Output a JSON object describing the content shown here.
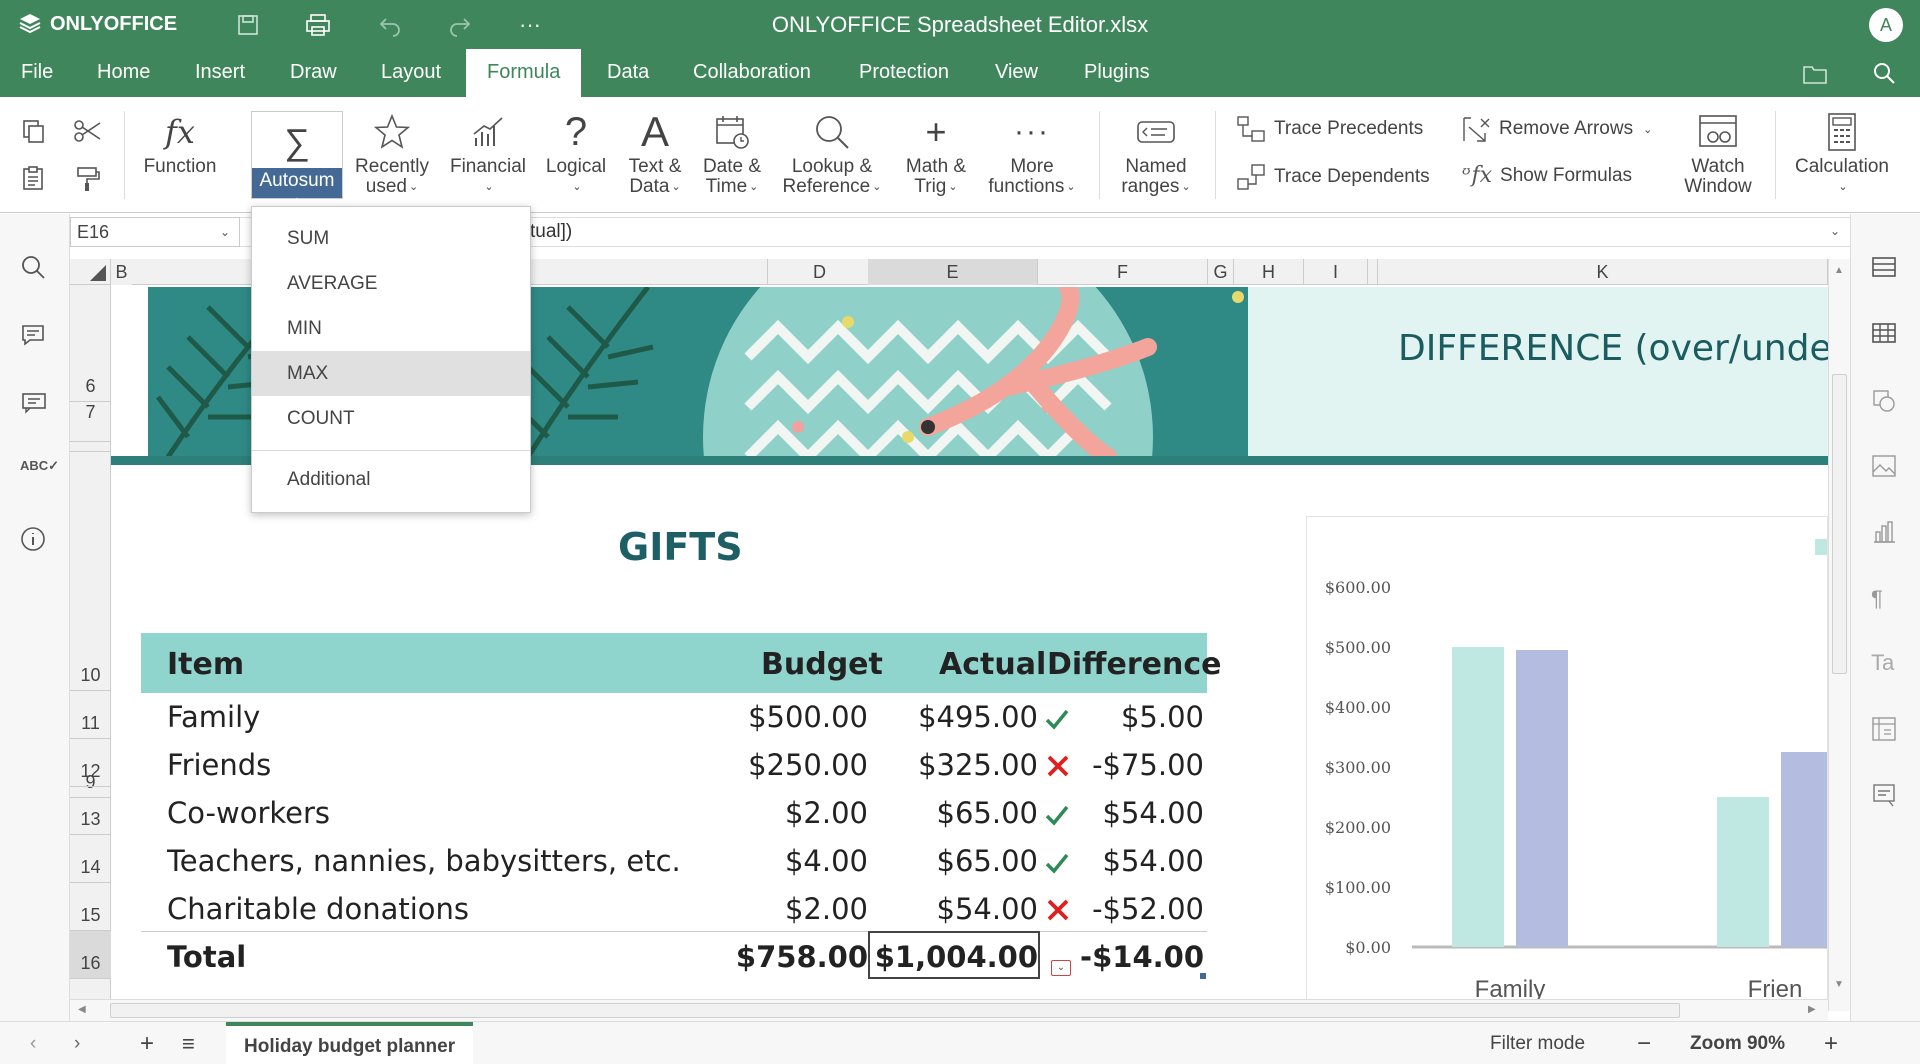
{
  "app": {
    "logo_text": "ONLYOFFICE",
    "title": "ONLYOFFICE Spreadsheet Editor.xlsx",
    "user_initial": "A"
  },
  "tabs": [
    "File",
    "Home",
    "Insert",
    "Draw",
    "Layout",
    "Formula",
    "Data",
    "Collaboration",
    "Protection",
    "View",
    "Plugins"
  ],
  "active_tab": "Formula",
  "toolbar": {
    "function": "Function",
    "autosum": "Autosum",
    "recently_used": "Recently\nused",
    "financial": "Financial",
    "logical": "Logical",
    "text_data": "Text &\nData",
    "date_time": "Date &\nTime",
    "lookup": "Lookup &\nReference",
    "math": "Math &\nTrig",
    "more_functions": "More\nfunctions",
    "named_ranges": "Named\nranges",
    "trace_precedents": "Trace Precedents",
    "trace_dependents": "Trace Dependents",
    "remove_arrows": "Remove Arrows",
    "show_formulas": "Show Formulas",
    "watch_window": "Watch\nWindow",
    "calculation": "Calculation"
  },
  "formula_bar": {
    "cell_ref": "E16",
    "formula_visible": "tual])"
  },
  "autosum_menu": {
    "items": [
      "SUM",
      "AVERAGE",
      "MIN",
      "MAX",
      "COUNT"
    ],
    "highlighted": "MAX",
    "additional": "Additional"
  },
  "columns": [
    "B",
    "D",
    "E",
    "F",
    "G",
    "H",
    "I",
    "K"
  ],
  "selected_column": "E",
  "rows": [
    "6",
    "7",
    "9",
    "10",
    "11",
    "12",
    "13",
    "14",
    "15",
    "16"
  ],
  "selected_row": "16",
  "sheet": {
    "banner_title": "DIFFERENCE (over/under",
    "section_title": "GIFTS",
    "headers": [
      "Item",
      "Budget",
      "Actual",
      "Difference"
    ],
    "rows": [
      {
        "item": "Family",
        "budget": "$500.00",
        "actual": "$495.00",
        "status": "ok",
        "difference": "$5.00"
      },
      {
        "item": "Friends",
        "budget": "$250.00",
        "actual": "$325.00",
        "status": "over",
        "difference": "-$75.00"
      },
      {
        "item": "Co-workers",
        "budget": "$2.00",
        "actual": "$65.00",
        "status": "ok",
        "difference": "$54.00"
      },
      {
        "item": "Teachers, nannies, babysitters, etc.",
        "budget": "$4.00",
        "actual": "$65.00",
        "status": "ok",
        "difference": "$54.00"
      },
      {
        "item": "Charitable donations",
        "budget": "$2.00",
        "actual": "$54.00",
        "status": "over",
        "difference": "-$52.00"
      }
    ],
    "total": {
      "label": "Total",
      "budget": "$758.00",
      "actual": "$1,004.00",
      "difference": "-$14.00"
    }
  },
  "chart_data": {
    "type": "bar",
    "categories": [
      "Family",
      "Frien"
    ],
    "series": [
      {
        "values": [
          500,
          250
        ]
      },
      {
        "values": [
          495,
          325
        ]
      }
    ],
    "colors": [
      "#bfe8e2",
      "#b4bce0"
    ],
    "ylim": [
      0,
      600
    ],
    "yticks": [
      "$0.00",
      "$100.00",
      "$200.00",
      "$300.00",
      "$400.00",
      "$500.00",
      "$600.00"
    ]
  },
  "statusbar": {
    "sheet_name": "Holiday budget planner",
    "filter_mode": "Filter mode",
    "zoom": "Zoom 90%"
  },
  "colors": {
    "brand": "#40865c",
    "header_fill": "#8fd5cd",
    "check": "#2e8b57",
    "cross": "#e02020",
    "autosum_active": "#446995"
  }
}
